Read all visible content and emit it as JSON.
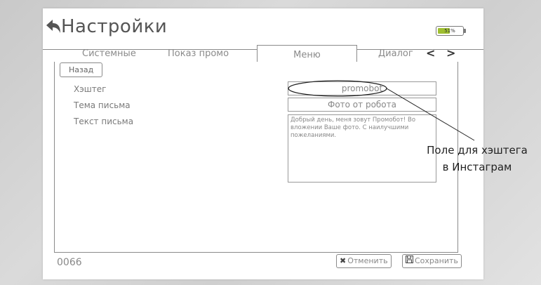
{
  "header": {
    "title": "Настройки",
    "back_icon": "back-arrow-icon",
    "battery": {
      "percent_label": "51%",
      "level": 0.51,
      "fill_color": "#9fbf2f"
    }
  },
  "tabs": [
    {
      "label": "Системные",
      "active": false
    },
    {
      "label": "Показ промо",
      "active": false
    },
    {
      "label": "Меню",
      "active": true
    },
    {
      "label": "Диалог",
      "active": false
    }
  ],
  "tab_nav": {
    "prev_icon": "chevron-left-icon",
    "next_icon": "chevron-right-icon",
    "prev": "<",
    "next": ">"
  },
  "content": {
    "back_button": "Назад",
    "fields": {
      "hashtag": {
        "label": "Хэштег",
        "value": "promobot"
      },
      "subject": {
        "label": "Тема письма",
        "value": "Фото от робота"
      },
      "body": {
        "label": "Текст письма",
        "value": "Добрый день, меня зовут Промобот! Во вложении Ваше фото. С наилучшими пожеланиями."
      }
    }
  },
  "footer": {
    "code": "0066",
    "cancel_label": "Отменить",
    "cancel_icon": "close-icon",
    "save_label": "Сохранить",
    "save_icon": "save-icon"
  },
  "annotation": {
    "line1": "Поле для хэштега",
    "line2": "в Инстаграм"
  }
}
